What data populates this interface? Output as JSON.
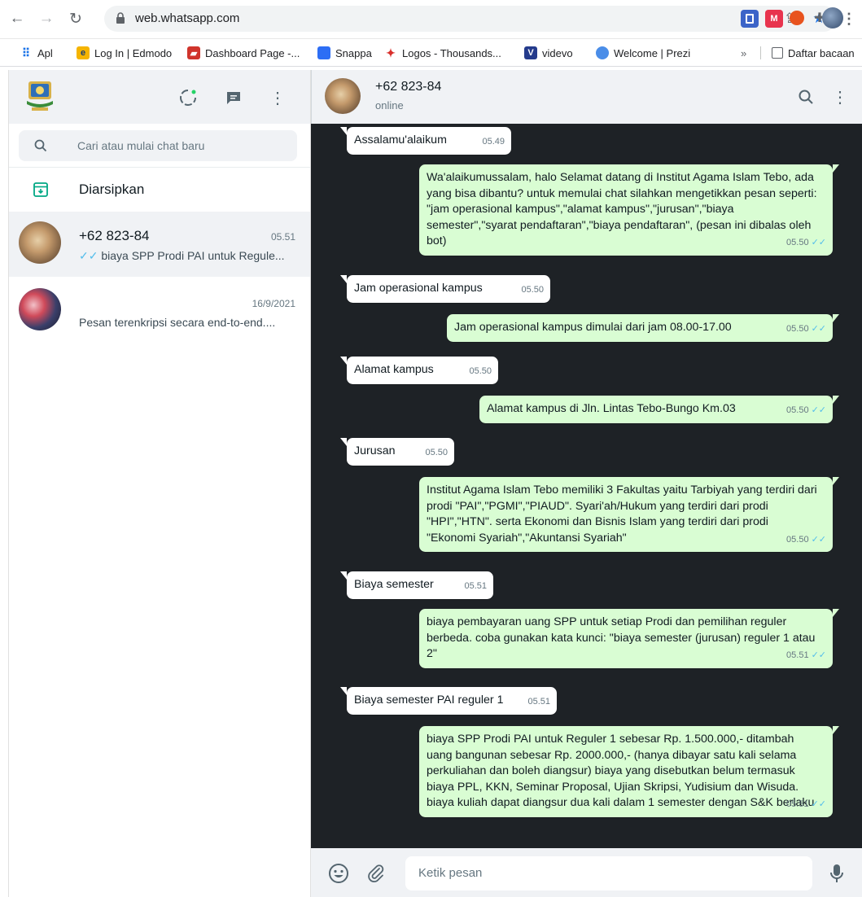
{
  "browser": {
    "url": "web.whatsapp.com",
    "bookmarks": [
      {
        "label": "Apl",
        "icon": "apps-grid-icon"
      },
      {
        "label": "Log In | Edmodo",
        "icon": "edmodo-icon"
      },
      {
        "label": "Dashboard Page -...",
        "icon": "dashboard-icon"
      },
      {
        "label": "Snappa",
        "icon": "snappa-icon"
      },
      {
        "label": "Logos - Thousands...",
        "icon": "logos-icon"
      },
      {
        "label": "videvo",
        "icon": "videvo-icon"
      },
      {
        "label": "Welcome | Prezi",
        "icon": "prezi-icon"
      }
    ],
    "more_bookmarks": "»",
    "reading_list": "Daftar bacaan"
  },
  "sidebar": {
    "search_placeholder": "Cari atau mulai chat baru",
    "archived_label": "Diarsipkan",
    "chats": [
      {
        "name": "+62 823-84",
        "time": "05.51",
        "preview": "biaya SPP Prodi PAI untuk Regule...",
        "read_ticks": true
      },
      {
        "name": "",
        "time": "16/9/2021",
        "preview": "Pesan terenkripsi secara end-to-end....",
        "read_ticks": false
      }
    ]
  },
  "conversation": {
    "contact_name": "+62 823-84",
    "status": "online",
    "messages": [
      {
        "dir": "in",
        "text": "Assalamu'alaikum",
        "time": "05.49"
      },
      {
        "dir": "out",
        "text": "Wa'alaikumussalam, halo Selamat datang di Institut Agama Islam Tebo, ada yang bisa dibantu? untuk memulai chat silahkan mengetikkan pesan seperti: \"jam operasional kampus\",\"alamat kampus\",\"jurusan\",\"biaya semester\",\"syarat pendaftaran\",\"biaya pendaftaran\", (pesan ini dibalas oleh bot)",
        "time": "05.50"
      },
      {
        "dir": "in",
        "text": "Jam operasional kampus",
        "time": "05.50"
      },
      {
        "dir": "out",
        "text": "Jam operasional kampus dimulai dari jam 08.00-17.00",
        "time": "05.50"
      },
      {
        "dir": "in",
        "text": "Alamat kampus",
        "time": "05.50"
      },
      {
        "dir": "out",
        "text": "Alamat kampus di Jln. Lintas Tebo-Bungo Km.03",
        "time": "05.50"
      },
      {
        "dir": "in",
        "text": "Jurusan",
        "time": "05.50"
      },
      {
        "dir": "out",
        "text": "Institut Agama Islam Tebo memiliki 3 Fakultas yaitu Tarbiyah yang terdiri dari prodi \"PAI\",\"PGMI\",\"PIAUD\". Syari'ah/Hukum yang terdiri dari prodi \"HPI\",\"HTN\". serta Ekonomi dan Bisnis Islam yang terdiri dari prodi \"Ekonomi Syariah\",\"Akuntansi Syariah\"",
        "time": "05.50"
      },
      {
        "dir": "in",
        "text": "Biaya semester",
        "time": "05.51"
      },
      {
        "dir": "out",
        "text": "biaya pembayaran uang SPP untuk setiap Prodi dan pemilihan reguler berbeda. coba gunakan kata kunci: \"biaya semester (jurusan) reguler 1 atau 2\"",
        "time": "05.51"
      },
      {
        "dir": "in",
        "text": "Biaya semester PAI reguler 1",
        "time": "05.51"
      },
      {
        "dir": "out",
        "text": "biaya SPP Prodi PAI untuk Reguler 1 sebesar Rp. 1.500.000,- ditambah uang bangunan sebesar Rp. 2000.000,- (hanya dibayar satu kali selama perkuliahan dan boleh diangsur) biaya yang disebutkan belum termasuk biaya PPL, KKN, Seminar Proposal, Ujian Skripsi, Yudisium dan Wisuda. biaya kuliah dapat diangsur dua kali dalam 1 semester dengan S&K berlaku",
        "time": "05.51"
      }
    ]
  },
  "composer": {
    "placeholder": "Ketik pesan"
  },
  "colors": {
    "outgoing_bubble": "#d9fdd3",
    "incoming_bubble": "#ffffff",
    "chat_background": "#1e2226",
    "read_ticks": "#53bdeb"
  }
}
